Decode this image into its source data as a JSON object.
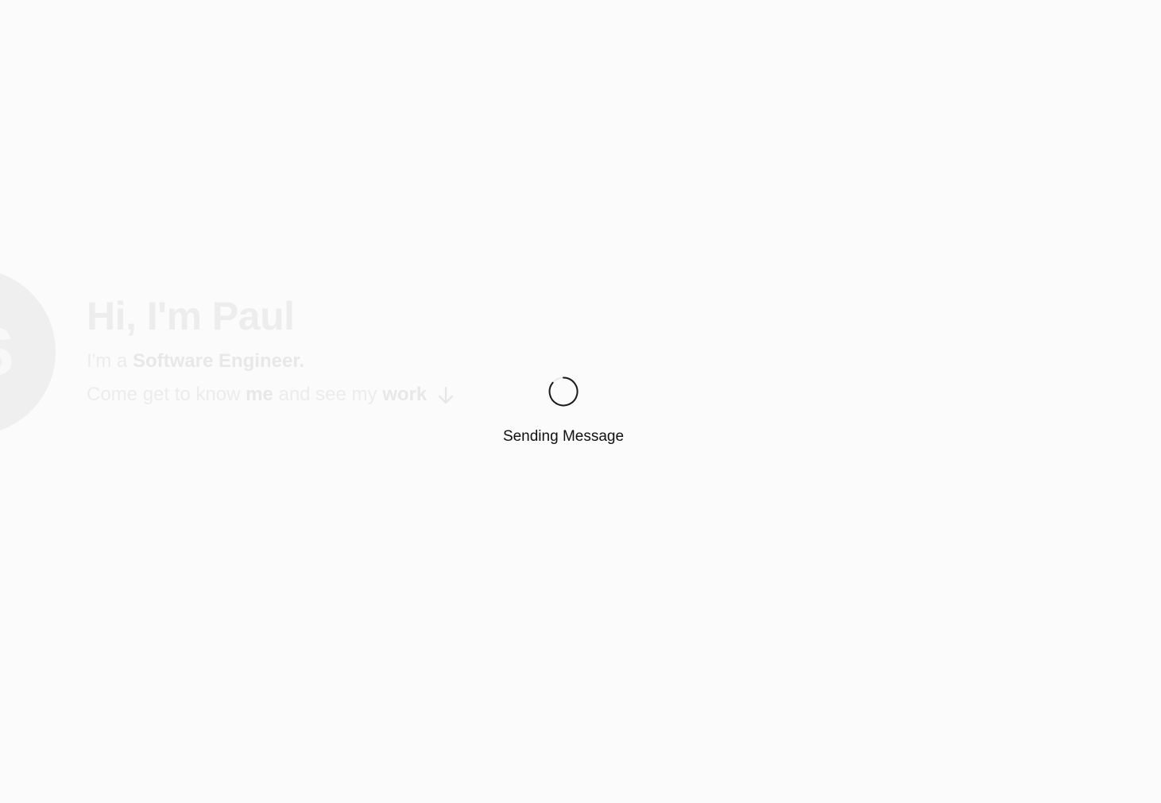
{
  "hero": {
    "avatar_letter": "S",
    "title": "Hi, I'm Paul",
    "line1_prefix": "I'm a ",
    "line1_role": "Software Engineer.",
    "line2_part1": "Come get to know ",
    "line2_me": "me",
    "line2_part2": " and see my ",
    "line2_work": "work",
    "scroll_icon": "arrow-down-icon"
  },
  "overlay": {
    "spinner_icon": "spinner-icon",
    "status_text": "Sending Message"
  },
  "colors": {
    "background": "#fbfbfb",
    "faded_text": "#ececec",
    "status_text": "#111111",
    "spinner": "#1a1a1a"
  }
}
